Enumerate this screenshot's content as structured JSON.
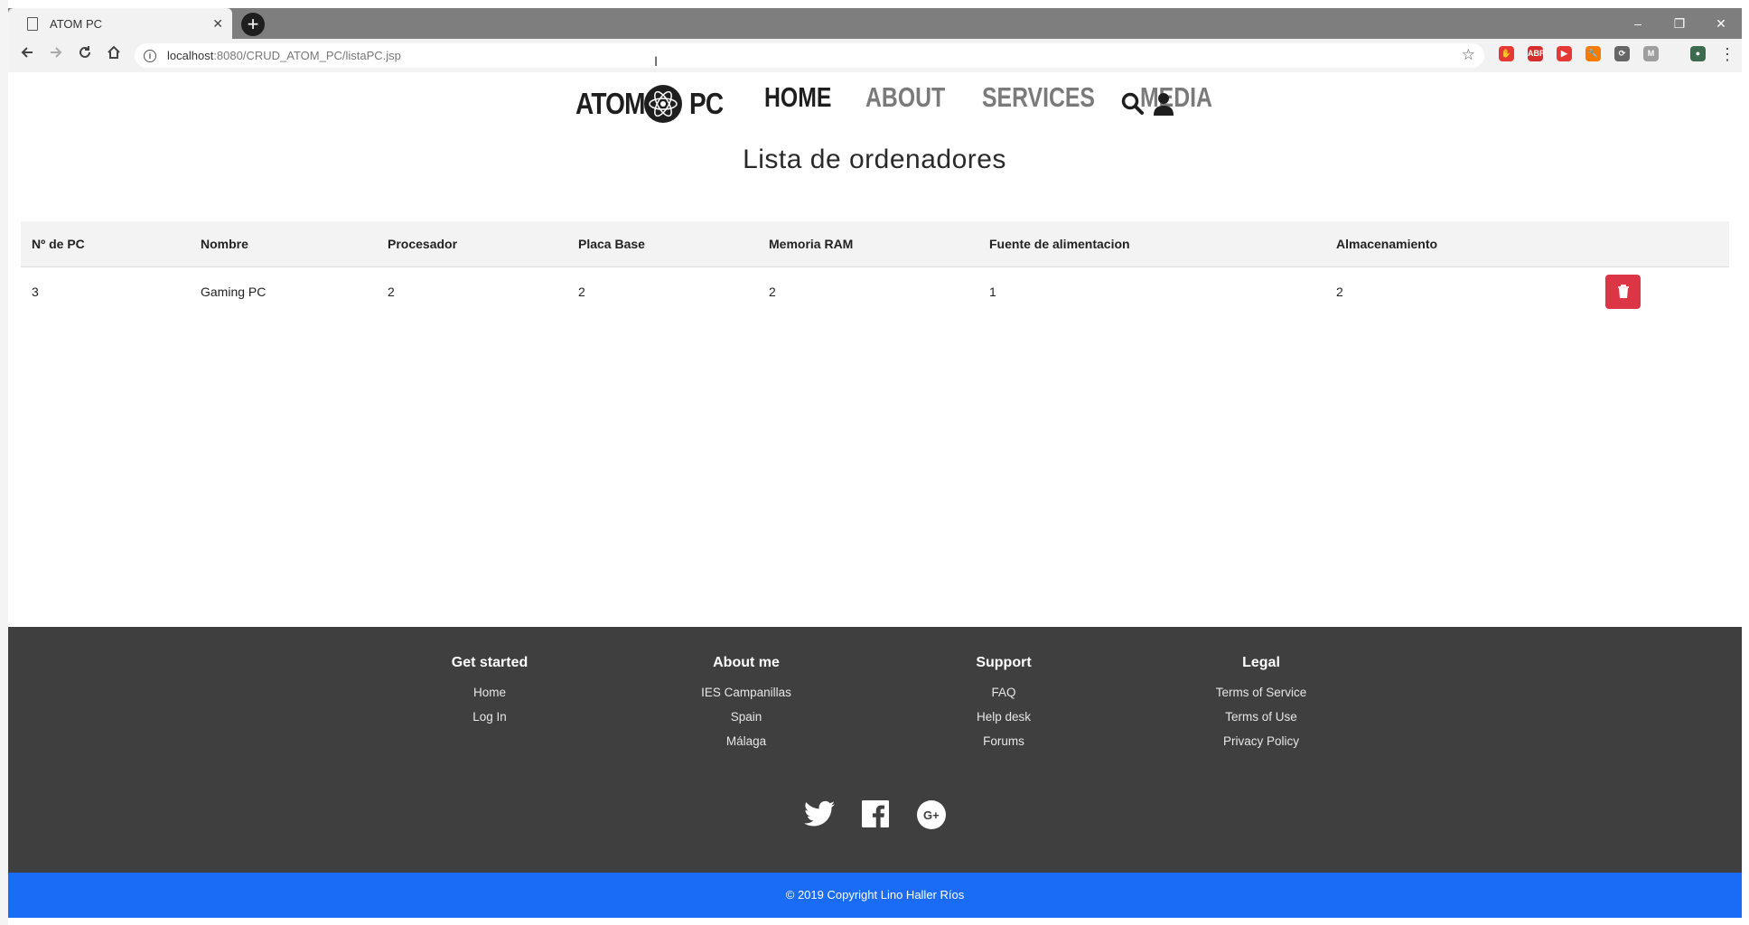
{
  "browser": {
    "tab_title": "ATOM PC",
    "tab_close": "✕",
    "new_tab": "+",
    "url_host": "localhost",
    "url_path": ":8080/CRUD_ATOM_PC/listaPC.jsp",
    "window_controls": [
      "–",
      "❐",
      "✕"
    ],
    "extensions": [
      {
        "name": "stop-extension-icon",
        "color": "#e53935",
        "label": "✋"
      },
      {
        "name": "adblock-icon",
        "color": "#d32f2f",
        "label": "ABP"
      },
      {
        "name": "video-extension-icon",
        "color": "#e53935",
        "label": "▶"
      },
      {
        "name": "wrench-extension-icon",
        "color": "#f57c00",
        "label": "🔧"
      },
      {
        "name": "sync-extension-icon",
        "color": "#666666",
        "label": "⟳"
      },
      {
        "name": "m-extension-icon",
        "color": "#9e9e9e",
        "label": "M"
      },
      {
        "name": "profile-avatar-icon",
        "color": "#3d6b4f",
        "label": "●"
      }
    ]
  },
  "header": {
    "logo_left": "ATOM",
    "logo_right": "PC",
    "nav": [
      {
        "label": "HOME",
        "active": true
      },
      {
        "label": "ABOUT",
        "active": false
      },
      {
        "label": "SERVICES",
        "active": false
      },
      {
        "label": "MEDIA",
        "active": false
      }
    ]
  },
  "main": {
    "title": "Lista de ordenadores",
    "table": {
      "columns": [
        "Nº de PC",
        "Nombre",
        "Procesador",
        "Placa Base",
        "Memoria RAM",
        "Fuente de alimentacion",
        "Almacenamiento"
      ],
      "rows": [
        [
          "3",
          "Gaming PC",
          "2",
          "2",
          "2",
          "1",
          "2"
        ]
      ]
    }
  },
  "footer": {
    "columns": [
      {
        "heading": "Get started",
        "links": [
          "Home",
          "Log In"
        ]
      },
      {
        "heading": "About me",
        "links": [
          "IES Campanillas",
          "Spain",
          "Málaga"
        ]
      },
      {
        "heading": "Support",
        "links": [
          "FAQ",
          "Help desk",
          "Forums"
        ]
      },
      {
        "heading": "Legal",
        "links": [
          "Terms of Service",
          "Terms of Use",
          "Privacy Policy"
        ]
      }
    ],
    "copyright": "© 2019 Copyright Lino Haller Ríos"
  },
  "colors": {
    "brand_blue": "#1a6cf7",
    "delete_red": "#dc3545",
    "footer_bg": "#3f3f3f"
  }
}
